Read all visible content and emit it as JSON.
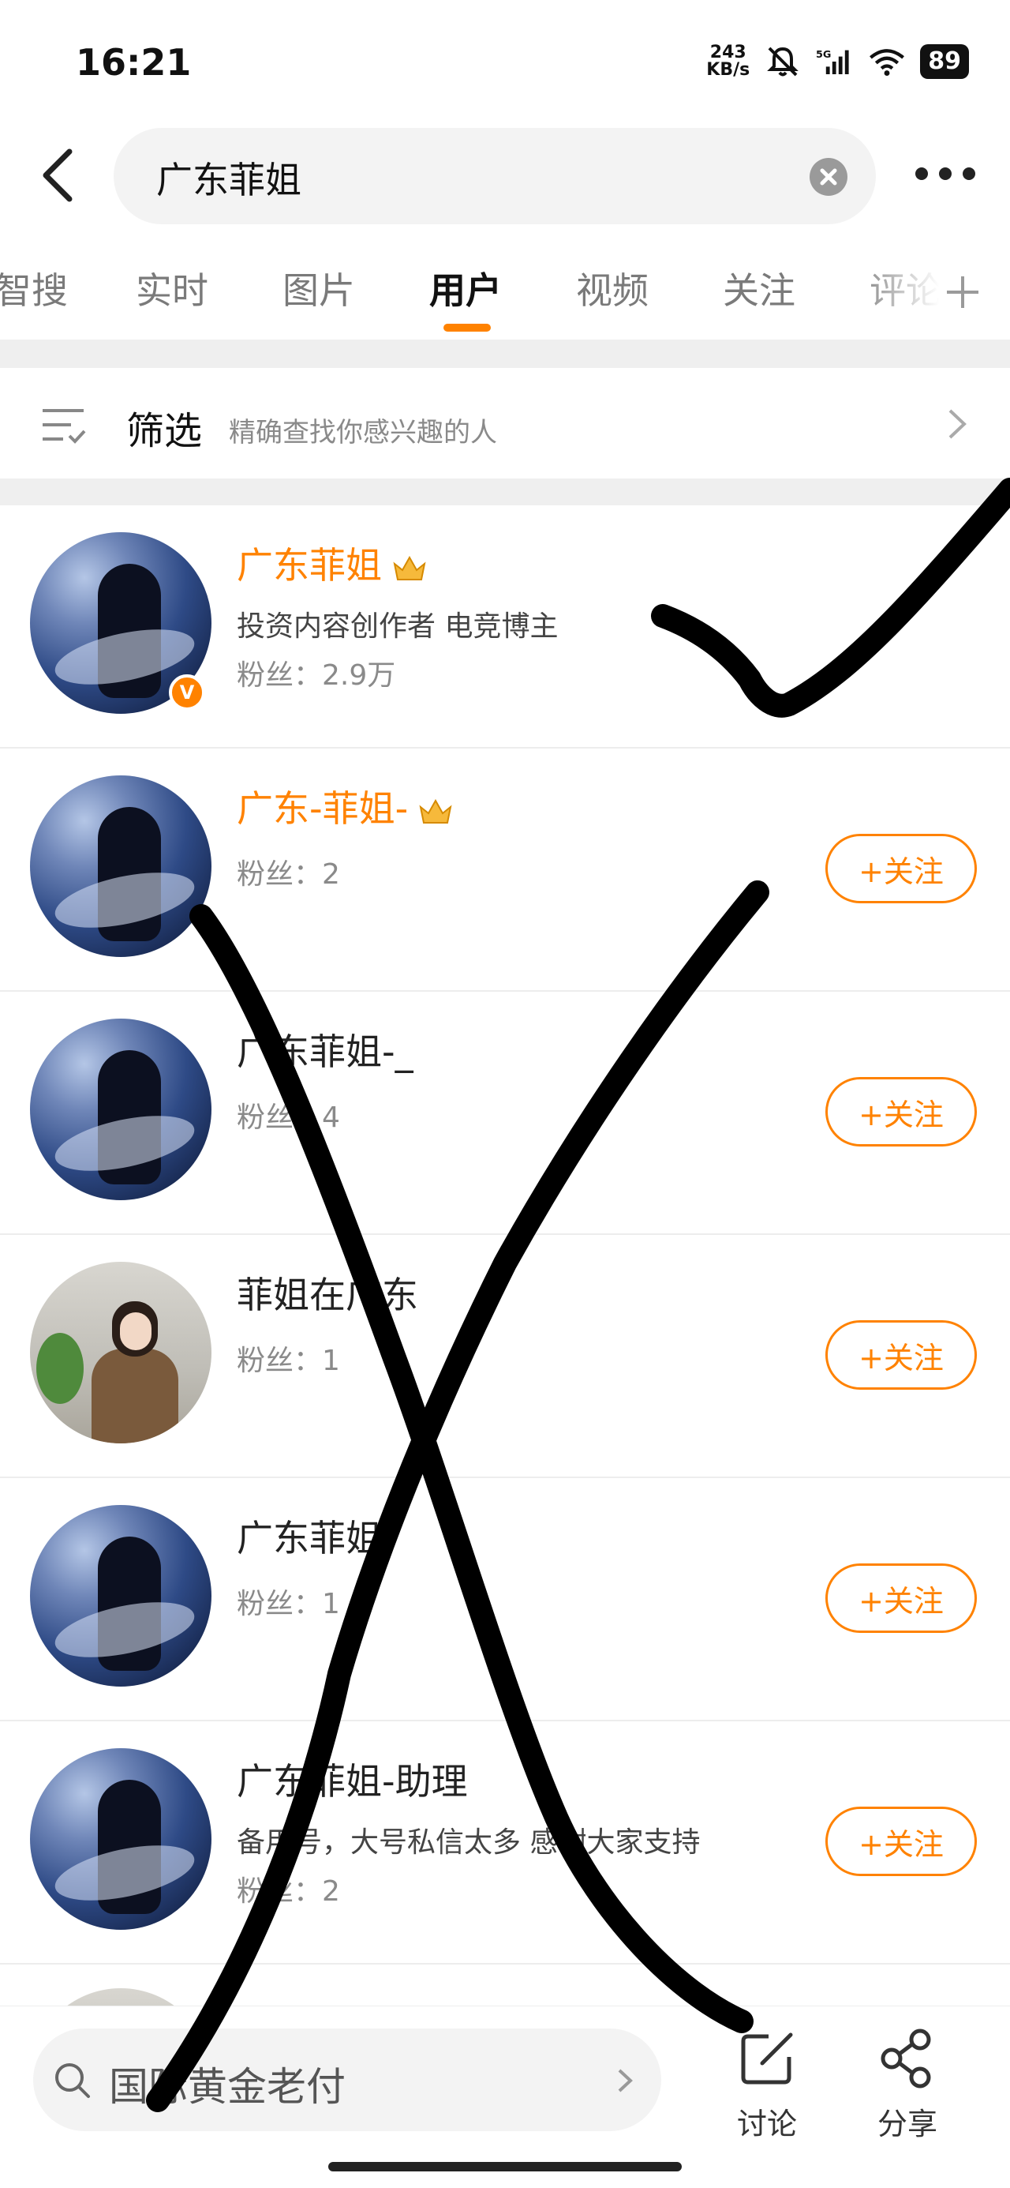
{
  "status_bar": {
    "time": "16:21",
    "net_speed_value": "243",
    "net_speed_unit": "KB/s",
    "network_type": "5G",
    "battery": "89",
    "icons": [
      "mute-bell-icon",
      "signal-icon",
      "wifi-icon",
      "battery-icon"
    ]
  },
  "search": {
    "query": "广东菲姐"
  },
  "tabs": [
    {
      "label": "智搜"
    },
    {
      "label": "实时"
    },
    {
      "label": "图片"
    },
    {
      "label": "用户"
    },
    {
      "label": "视频"
    },
    {
      "label": "关注"
    },
    {
      "label": "评论"
    }
  ],
  "active_tab": "用户",
  "filter": {
    "title": "筛选",
    "description": "精确查找你感兴趣的人"
  },
  "users": [
    {
      "name": "广东菲姐",
      "vip": true,
      "verified": true,
      "description": "投资内容创作者 电竞博主",
      "fans": "粉丝：2.9万",
      "follow": ""
    },
    {
      "name": "广东-菲姐-",
      "vip": true,
      "verified": false,
      "description": "",
      "fans": "粉丝：2",
      "follow": "+关注"
    },
    {
      "name": "广东菲姐-_",
      "vip": false,
      "verified": false,
      "description": "",
      "fans": "粉丝：4",
      "follow": "+关注"
    },
    {
      "name": "菲姐在广东",
      "vip": false,
      "verified": false,
      "description": "",
      "fans": "粉丝：1",
      "follow": "+关注"
    },
    {
      "name": "广东菲姐",
      "vip": false,
      "verified": false,
      "description": "",
      "fans": "粉丝：1",
      "follow": "+关注"
    },
    {
      "name": "广东菲姐-助理",
      "vip": false,
      "verified": false,
      "description": "备用号，大号私信太多 感谢大家支持",
      "fans": "粉丝：2",
      "follow": "+关注"
    }
  ],
  "bottom_bar": {
    "search_text": "国际黄金老付",
    "discuss_label": "讨论",
    "share_label": "分享"
  },
  "colors": {
    "accent": "#ff8200",
    "annotation_ink": "#000000"
  }
}
